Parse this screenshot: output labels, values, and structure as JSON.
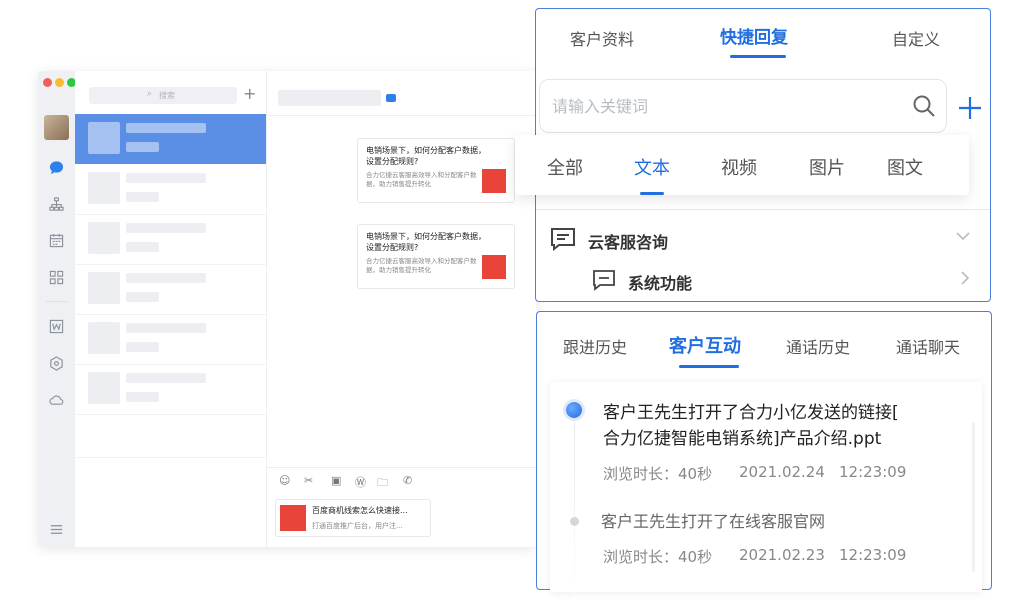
{
  "bg_window": {
    "search_placeholder": "搜索",
    "add_icon": "plus-icon",
    "messages": [
      {
        "title": "电销场景下，如何分配客户数据，设置分配规则?",
        "summary": "合力亿捷云客服高效导入和分配客户数据，助力销售提升转化"
      },
      {
        "title": "电销场景下，如何分配客户数据，设置分配规则?",
        "summary": "合力亿捷云客服高效导入和分配客户数据，助力销售提升转化"
      }
    ],
    "bottom_card": {
      "title": "百度商机线索怎么快速接...",
      "summary": "打通百度推广后台，用户注..."
    }
  },
  "top_panel": {
    "tabs": [
      "客户资料",
      "快捷回复",
      "自定义"
    ],
    "active_tab": "快捷回复",
    "search_placeholder": "请输入关键词",
    "subtabs": [
      "全部",
      "文本",
      "视频",
      "图片",
      "图文"
    ],
    "active_subtab": "文本",
    "tree": [
      {
        "label": "云客服咨询",
        "icon": "message-square-icon"
      },
      {
        "label": "系统功能",
        "icon": "message-square-icon"
      }
    ]
  },
  "bottom_panel": {
    "tabs": [
      "跟进历史",
      "客户互动",
      "通话历史",
      "通话聊天"
    ],
    "active_tab": "客户互动",
    "events": [
      {
        "text_line1": "客户王先生打开了合力小亿发送的链接[",
        "text_line2": "合力亿捷智能电销系统]产品介绍.ppt",
        "meta_label": "浏览时长：40秒",
        "date": "2021.02.24",
        "time": "12:23:09"
      },
      {
        "text_line1": "客户王先生打开了在线客服官网",
        "text_line2": "",
        "meta_label": "浏览时长：40秒",
        "date": "2021.02.23",
        "time": "12:23:09"
      }
    ]
  },
  "colors": {
    "accent": "#1f6fe0",
    "panel_border": "#4a7fe0",
    "selected_row": "#5b8fe6"
  }
}
